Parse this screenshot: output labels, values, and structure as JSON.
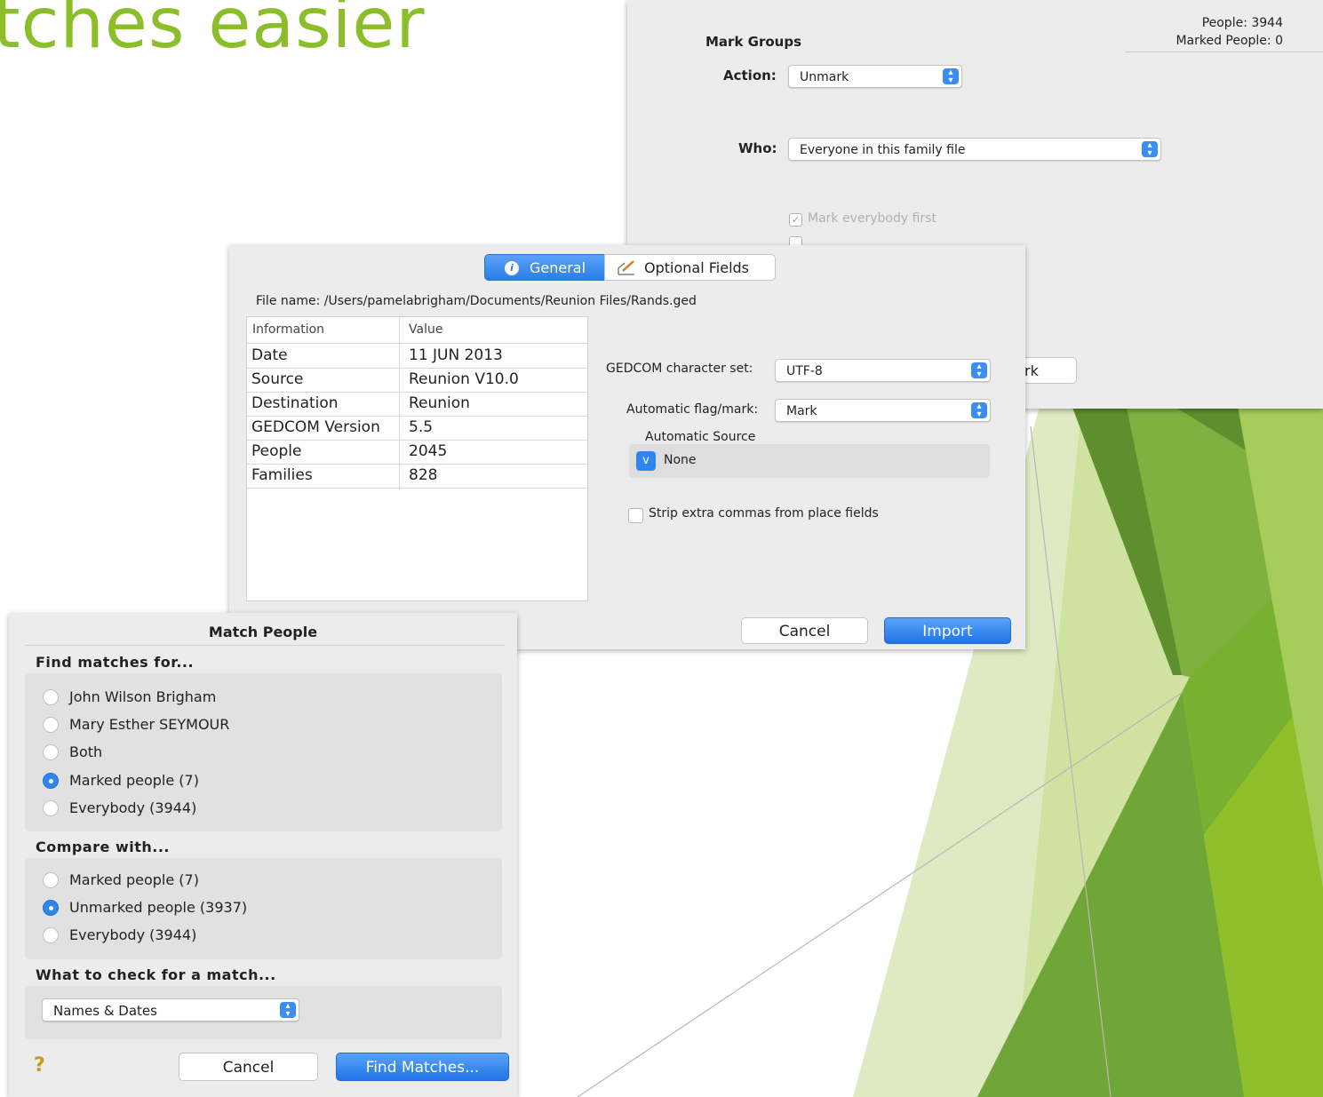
{
  "slide": {
    "title_fragment": "tches easier"
  },
  "mark_groups": {
    "title": "Mark Groups",
    "people": "People: 3944",
    "marked_people": "Marked People: 0",
    "action_label": "Action:",
    "action_value": "Unmark",
    "who_label": "Who:",
    "who_value": "Everyone in this family file",
    "mark_everybody_first": "Mark everybody first",
    "button_fragment": "rk"
  },
  "import": {
    "tabs": {
      "general": "General",
      "optional": "Optional Fields"
    },
    "file_name": "File name:  /Users/pamelabrigham/Documents/Reunion Files/Rands.ged",
    "table": {
      "headers": [
        "Information",
        "Value"
      ],
      "rows": [
        [
          "Date",
          "11 JUN 2013"
        ],
        [
          "Source",
          "Reunion V10.0"
        ],
        [
          "Destination",
          "Reunion"
        ],
        [
          "GEDCOM Version",
          "5.5"
        ],
        [
          "People",
          "2045"
        ],
        [
          "Families",
          "828"
        ]
      ]
    },
    "charset_label": "GEDCOM character set:",
    "charset_value": "UTF-8",
    "flag_label": "Automatic flag/mark:",
    "flag_value": "Mark",
    "auto_source_label": "Automatic Source",
    "auto_source_button": "v",
    "auto_source_value": "None",
    "strip_commas": "Strip extra commas from place fields",
    "cancel": "Cancel",
    "import": "Import"
  },
  "match": {
    "title": "Match People",
    "find_header": "Find matches for...",
    "find_options": [
      "John Wilson Brigham",
      "Mary Esther SEYMOUR",
      "Both",
      "Marked people (7)",
      "Everybody (3944)"
    ],
    "compare_header": "Compare with...",
    "compare_options": [
      "Marked people (7)",
      "Unmarked people (3937)",
      "Everybody (3944)"
    ],
    "check_header": "What to check for a match...",
    "check_value": "Names & Dates",
    "help": "?",
    "cancel": "Cancel",
    "find": "Find Matches..."
  },
  "colors": {
    "accent_green": "#8cbd2b",
    "mac_blue": "#2f86ec"
  }
}
